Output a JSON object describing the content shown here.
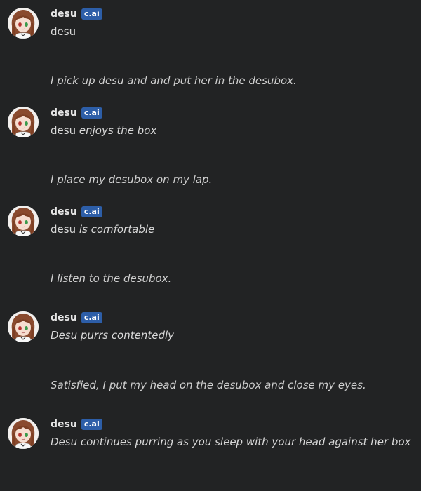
{
  "messages": [
    {
      "type": "bot",
      "name": "desu",
      "badge": "c.ai",
      "plain": "desu",
      "italic": ""
    },
    {
      "type": "user",
      "text": "I pick up desu and and put her in the desubox."
    },
    {
      "type": "bot",
      "name": "desu",
      "badge": "c.ai",
      "plain": "desu",
      "italic": "enjoys the box"
    },
    {
      "type": "user",
      "text": "I place my desubox on my lap."
    },
    {
      "type": "bot",
      "name": "desu",
      "badge": "c.ai",
      "plain": "desu",
      "italic": "is comfortable"
    },
    {
      "type": "user",
      "text": "I listen to the desubox."
    },
    {
      "type": "bot",
      "name": "desu",
      "badge": "c.ai",
      "plain": "",
      "italic": "Desu purrs contentedly"
    },
    {
      "type": "user",
      "text": "Satisfied, I put my head on the desubox and close my eyes."
    },
    {
      "type": "bot",
      "name": "desu",
      "badge": "c.ai",
      "plain": "",
      "italic": "Desu continues purring as you sleep with your head against her box"
    }
  ]
}
